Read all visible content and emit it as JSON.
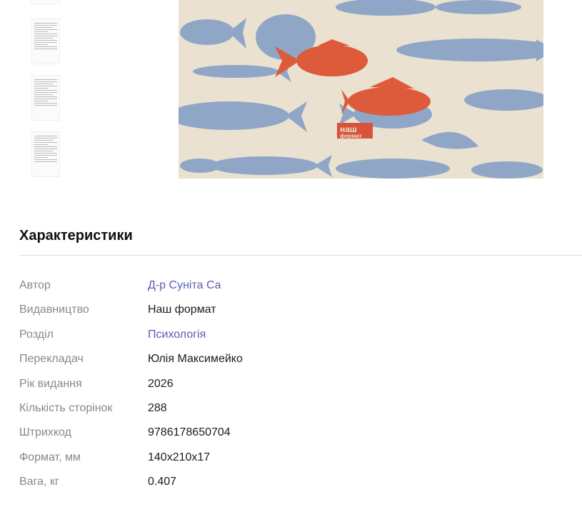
{
  "gallery": {
    "thumbnail_alt": "page preview",
    "cover": {
      "publisher_logo_line1": "наш",
      "publisher_logo_line2": "формат",
      "colors": {
        "background": "#eae1d0",
        "fish_blue": "#8fa6c6",
        "fish_red": "#dd5a3a"
      }
    }
  },
  "characteristics": {
    "title": "Характеристики",
    "rows": [
      {
        "label": "Автор",
        "value": "Д-р Суніта Са",
        "link": true
      },
      {
        "label": "Видавництво",
        "value": "Наш формат",
        "link": false
      },
      {
        "label": "Розділ",
        "value": "Психологія",
        "link": true
      },
      {
        "label": "Перекладач",
        "value": "Юлія Максимейко",
        "link": false
      },
      {
        "label": "Рік видання",
        "value": "2026",
        "link": false
      },
      {
        "label": "Кількість сторінок",
        "value": "288",
        "link": false
      },
      {
        "label": "Штрихкод",
        "value": "9786178650704",
        "link": false
      },
      {
        "label": "Формат, мм",
        "value": "140x210x17",
        "link": false
      },
      {
        "label": "Вага, кг",
        "value": "0.407",
        "link": false
      }
    ]
  },
  "colors": {
    "link": "#5a5cb8",
    "label": "#888888",
    "value": "#1b1b1b"
  }
}
